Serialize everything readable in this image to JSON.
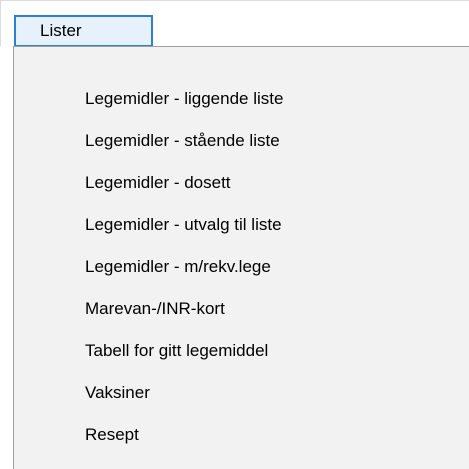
{
  "menubar": {
    "active_menu_label": "Lister"
  },
  "dropdown": {
    "items": [
      {
        "label": "Legemidler - liggende liste"
      },
      {
        "label": "Legemidler - stående liste"
      },
      {
        "label": "Legemidler - dosett"
      },
      {
        "label": "Legemidler - utvalg til liste"
      },
      {
        "label": "Legemidler - m/rekv.lege"
      },
      {
        "label": "Marevan-/INR-kort"
      },
      {
        "label": "Tabell for gitt legemiddel"
      },
      {
        "label": "Vaksiner"
      },
      {
        "label": "Resept"
      }
    ]
  },
  "colors": {
    "menu_highlight_border": "#2f7fd1",
    "menu_highlight_fill": "#e7f1fb",
    "dropdown_background": "#f2f2f2",
    "dropdown_border": "#a0a0a0"
  }
}
